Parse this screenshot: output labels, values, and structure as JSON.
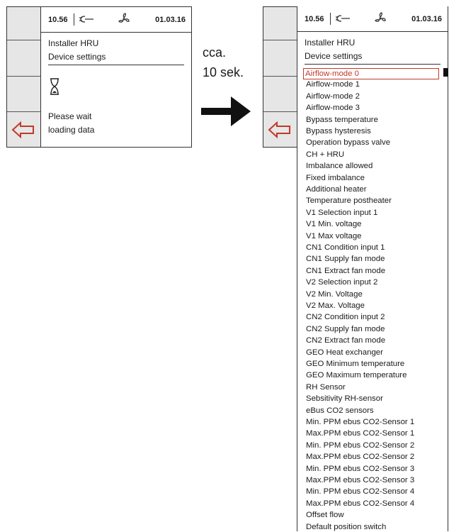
{
  "colors": {
    "accent_red": "#c0392b",
    "panel_gray": "#e6e6e6",
    "border": "#333333"
  },
  "left_panel": {
    "status": {
      "time": "10.56",
      "date": "01.03.16",
      "plug_icon": "plug-icon",
      "fan_icon": "fan-icon"
    },
    "title": "Installer HRU",
    "subtitle": "Device settings",
    "message_line1": "Please wait",
    "message_line2": "loading data"
  },
  "transition": {
    "line1": "cca.",
    "line2": "10 sek."
  },
  "right_panel": {
    "status": {
      "time": "10.56",
      "date": "01.03.16"
    },
    "title": "Installer HRU",
    "subtitle": "Device settings",
    "selected_index": 0,
    "menu": [
      "Airflow-mode 0",
      "Airflow-mode 1",
      "Airflow-mode 2",
      "Airflow-mode 3",
      "Bypass temperature",
      "Bypass hysteresis",
      "Operation bypass valve",
      "CH + HRU",
      "Imbalance allowed",
      "Fixed imbalance",
      "Additional heater",
      "Temperature postheater",
      "V1 Selection input 1",
      "V1 Min. voltage",
      "V1 Max voltage",
      "CN1 Condition input 1",
      "CN1 Supply fan mode",
      "CN1 Extract fan mode",
      "V2 Selection input 2",
      "V2 Min. Voltage",
      "V2 Max. Voltage",
      "CN2 Condition input 2",
      "CN2 Supply fan mode",
      "CN2 Extract fan mode",
      "GEO Heat exchanger",
      "GEO Minimum temperature",
      "GEO Maximum temperature",
      "RH Sensor",
      "Sebsitivity RH-sensor",
      "eBus CO2  sensors",
      "Min. PPM ebus CO2-Sensor 1",
      "Max.PPM ebus CO2-Sensor 1",
      "Min. PPM ebus CO2-Sensor 2",
      "Max.PPM ebus CO2-Sensor 2",
      "Min. PPM ebus CO2-Sensor 3",
      "Max.PPM ebus CO2-Sensor 3",
      "Min. PPM ebus CO2-Sensor 4",
      "Max.PPM ebus CO2-Sensor 4",
      "Offset flow",
      "Default position switch"
    ]
  }
}
